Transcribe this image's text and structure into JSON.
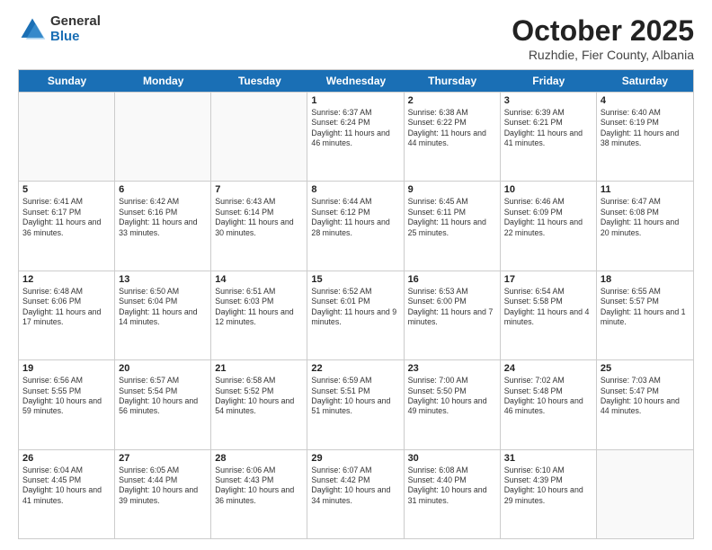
{
  "logo": {
    "general": "General",
    "blue": "Blue"
  },
  "header": {
    "month": "October 2025",
    "location": "Ruzhdie, Fier County, Albania"
  },
  "weekdays": [
    "Sunday",
    "Monday",
    "Tuesday",
    "Wednesday",
    "Thursday",
    "Friday",
    "Saturday"
  ],
  "rows": [
    [
      {
        "day": "",
        "info": ""
      },
      {
        "day": "",
        "info": ""
      },
      {
        "day": "",
        "info": ""
      },
      {
        "day": "1",
        "info": "Sunrise: 6:37 AM\nSunset: 6:24 PM\nDaylight: 11 hours\nand 46 minutes."
      },
      {
        "day": "2",
        "info": "Sunrise: 6:38 AM\nSunset: 6:22 PM\nDaylight: 11 hours\nand 44 minutes."
      },
      {
        "day": "3",
        "info": "Sunrise: 6:39 AM\nSunset: 6:21 PM\nDaylight: 11 hours\nand 41 minutes."
      },
      {
        "day": "4",
        "info": "Sunrise: 6:40 AM\nSunset: 6:19 PM\nDaylight: 11 hours\nand 38 minutes."
      }
    ],
    [
      {
        "day": "5",
        "info": "Sunrise: 6:41 AM\nSunset: 6:17 PM\nDaylight: 11 hours\nand 36 minutes."
      },
      {
        "day": "6",
        "info": "Sunrise: 6:42 AM\nSunset: 6:16 PM\nDaylight: 11 hours\nand 33 minutes."
      },
      {
        "day": "7",
        "info": "Sunrise: 6:43 AM\nSunset: 6:14 PM\nDaylight: 11 hours\nand 30 minutes."
      },
      {
        "day": "8",
        "info": "Sunrise: 6:44 AM\nSunset: 6:12 PM\nDaylight: 11 hours\nand 28 minutes."
      },
      {
        "day": "9",
        "info": "Sunrise: 6:45 AM\nSunset: 6:11 PM\nDaylight: 11 hours\nand 25 minutes."
      },
      {
        "day": "10",
        "info": "Sunrise: 6:46 AM\nSunset: 6:09 PM\nDaylight: 11 hours\nand 22 minutes."
      },
      {
        "day": "11",
        "info": "Sunrise: 6:47 AM\nSunset: 6:08 PM\nDaylight: 11 hours\nand 20 minutes."
      }
    ],
    [
      {
        "day": "12",
        "info": "Sunrise: 6:48 AM\nSunset: 6:06 PM\nDaylight: 11 hours\nand 17 minutes."
      },
      {
        "day": "13",
        "info": "Sunrise: 6:50 AM\nSunset: 6:04 PM\nDaylight: 11 hours\nand 14 minutes."
      },
      {
        "day": "14",
        "info": "Sunrise: 6:51 AM\nSunset: 6:03 PM\nDaylight: 11 hours\nand 12 minutes."
      },
      {
        "day": "15",
        "info": "Sunrise: 6:52 AM\nSunset: 6:01 PM\nDaylight: 11 hours\nand 9 minutes."
      },
      {
        "day": "16",
        "info": "Sunrise: 6:53 AM\nSunset: 6:00 PM\nDaylight: 11 hours\nand 7 minutes."
      },
      {
        "day": "17",
        "info": "Sunrise: 6:54 AM\nSunset: 5:58 PM\nDaylight: 11 hours\nand 4 minutes."
      },
      {
        "day": "18",
        "info": "Sunrise: 6:55 AM\nSunset: 5:57 PM\nDaylight: 11 hours\nand 1 minute."
      }
    ],
    [
      {
        "day": "19",
        "info": "Sunrise: 6:56 AM\nSunset: 5:55 PM\nDaylight: 10 hours\nand 59 minutes."
      },
      {
        "day": "20",
        "info": "Sunrise: 6:57 AM\nSunset: 5:54 PM\nDaylight: 10 hours\nand 56 minutes."
      },
      {
        "day": "21",
        "info": "Sunrise: 6:58 AM\nSunset: 5:52 PM\nDaylight: 10 hours\nand 54 minutes."
      },
      {
        "day": "22",
        "info": "Sunrise: 6:59 AM\nSunset: 5:51 PM\nDaylight: 10 hours\nand 51 minutes."
      },
      {
        "day": "23",
        "info": "Sunrise: 7:00 AM\nSunset: 5:50 PM\nDaylight: 10 hours\nand 49 minutes."
      },
      {
        "day": "24",
        "info": "Sunrise: 7:02 AM\nSunset: 5:48 PM\nDaylight: 10 hours\nand 46 minutes."
      },
      {
        "day": "25",
        "info": "Sunrise: 7:03 AM\nSunset: 5:47 PM\nDaylight: 10 hours\nand 44 minutes."
      }
    ],
    [
      {
        "day": "26",
        "info": "Sunrise: 6:04 AM\nSunset: 4:45 PM\nDaylight: 10 hours\nand 41 minutes."
      },
      {
        "day": "27",
        "info": "Sunrise: 6:05 AM\nSunset: 4:44 PM\nDaylight: 10 hours\nand 39 minutes."
      },
      {
        "day": "28",
        "info": "Sunrise: 6:06 AM\nSunset: 4:43 PM\nDaylight: 10 hours\nand 36 minutes."
      },
      {
        "day": "29",
        "info": "Sunrise: 6:07 AM\nSunset: 4:42 PM\nDaylight: 10 hours\nand 34 minutes."
      },
      {
        "day": "30",
        "info": "Sunrise: 6:08 AM\nSunset: 4:40 PM\nDaylight: 10 hours\nand 31 minutes."
      },
      {
        "day": "31",
        "info": "Sunrise: 6:10 AM\nSunset: 4:39 PM\nDaylight: 10 hours\nand 29 minutes."
      },
      {
        "day": "",
        "info": ""
      }
    ]
  ]
}
